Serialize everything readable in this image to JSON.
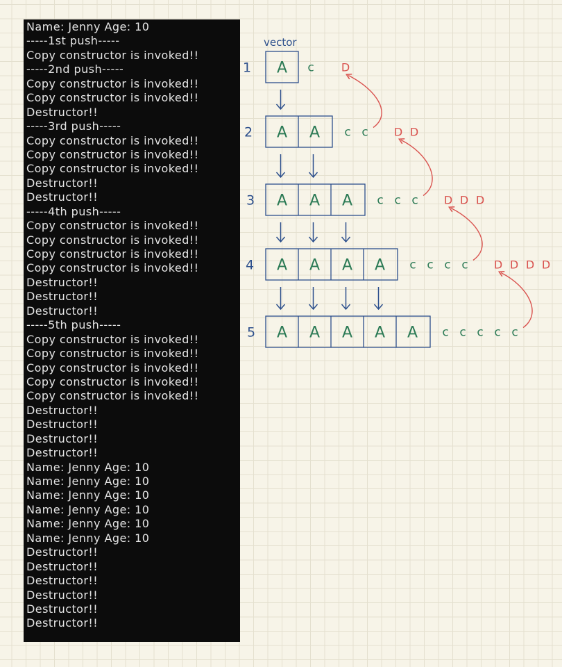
{
  "terminal": {
    "lines": [
      "Name: Jenny Age: 10",
      "-----1st push-----",
      "Copy constructor is invoked!!",
      "-----2nd push-----",
      "Copy constructor is invoked!!",
      "Copy constructor is invoked!!",
      "Destructor!!",
      "-----3rd push-----",
      "Copy constructor is invoked!!",
      "Copy constructor is invoked!!",
      "Copy constructor is invoked!!",
      "Destructor!!",
      "Destructor!!",
      "-----4th push-----",
      "Copy constructor is invoked!!",
      "Copy constructor is invoked!!",
      "Copy constructor is invoked!!",
      "Copy constructor is invoked!!",
      "Destructor!!",
      "Destructor!!",
      "Destructor!!",
      "-----5th push-----",
      "Copy constructor is invoked!!",
      "Copy constructor is invoked!!",
      "Copy constructor is invoked!!",
      "Copy constructor is invoked!!",
      "Copy constructor is invoked!!",
      "Destructor!!",
      "Destructor!!",
      "Destructor!!",
      "Destructor!!",
      "Name: Jenny Age: 10",
      "Name: Jenny Age: 10",
      "Name: Jenny Age: 10",
      "Name: Jenny Age: 10",
      "Name: Jenny Age: 10",
      "Name: Jenny Age: 10",
      "Destructor!!",
      "Destructor!!",
      "Destructor!!",
      "Destructor!!",
      "Destructor!!",
      "Destructor!!"
    ]
  },
  "diagram": {
    "vector_label": "vector",
    "cell_letter": "A",
    "copy_mark": "C",
    "destruct_mark": "D",
    "rows": [
      {
        "number": "1",
        "cells": 1,
        "copies": 1,
        "destructs": 1
      },
      {
        "number": "2",
        "cells": 2,
        "copies": 2,
        "destructs": 2
      },
      {
        "number": "3",
        "cells": 3,
        "copies": 3,
        "destructs": 3
      },
      {
        "number": "4",
        "cells": 4,
        "copies": 4,
        "destructs": 4
      },
      {
        "number": "5",
        "cells": 5,
        "copies": 5,
        "destructs": 0
      }
    ],
    "colors": {
      "box": "#2c4f8c",
      "number": "#2c4f8c",
      "arrow": "#2c4f8c",
      "letter": "#2b7a55",
      "copy": "#2b7a55",
      "destruct": "#d9534f",
      "curve": "#d9534f"
    }
  }
}
